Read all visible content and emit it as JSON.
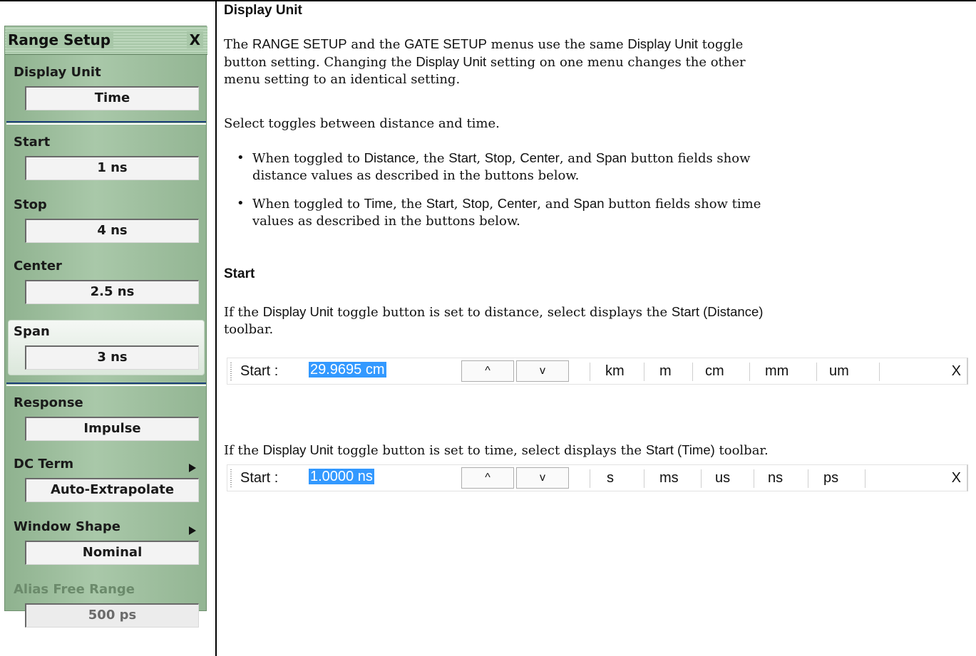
{
  "menu": {
    "title": "Range Setup",
    "close": "X",
    "items": [
      {
        "label": "Display Unit",
        "value": "Time"
      },
      {
        "label": "Start",
        "value": "1 ns"
      },
      {
        "label": "Stop",
        "value": "4 ns"
      },
      {
        "label": "Center",
        "value": "2.5 ns"
      },
      {
        "label": "Span",
        "value": "3 ns"
      },
      {
        "label": "Response",
        "value": "Impulse"
      },
      {
        "label": "DC Term",
        "value": "Auto-Extrapolate"
      },
      {
        "label": "Window Shape",
        "value": "Nominal"
      },
      {
        "label": "Alias Free Range",
        "value": "500 ps"
      }
    ]
  },
  "doc": {
    "display_unit": {
      "heading": "Display Unit",
      "p1": {
        "t1": "The ",
        "s1": "RANGE SETUP",
        "t2": " and the ",
        "s2": "GATE SETUP",
        "t3": " menus use the same ",
        "s3": "Display Unit",
        "t4": " toggle",
        "t5": "button setting. Changing the ",
        "s4": "Display Unit",
        "t6": " setting on one menu changes the other",
        "t7": "menu setting to an identical setting."
      },
      "p2": "Select toggles between distance and time.",
      "b1": {
        "t1": "When toggled to ",
        "s1": "Distance",
        "t2": ", the ",
        "s2": "Start",
        "t3": ", ",
        "s3": "Stop",
        "t4": ", ",
        "s4": "Center",
        "t5": ", and ",
        "s5": "Span",
        "t6": " button fields show",
        "t7": "distance values as described in the buttons below."
      },
      "b2": {
        "t1": "When toggled to ",
        "s1": "Time",
        "t2": ", the ",
        "s2": "Start",
        "t3": ", ",
        "s3": "Stop",
        "t4": ", ",
        "s4": "Center",
        "t5": ", and ",
        "s5": "Span",
        "t6": " button fields show time",
        "t7": "values as described in the buttons below."
      }
    },
    "start": {
      "heading": "Start",
      "p1": {
        "t1": "If the ",
        "s1": "Display Unit",
        "t2": " toggle button is set to distance, select displays the ",
        "s2": "Start (Distance)",
        "t3": "toolbar."
      },
      "p2": {
        "t1": "If the ",
        "s1": "Display Unit",
        "t2": " toggle button is set to time, select displays the ",
        "s2": "Start (Time)",
        "t3": " toolbar."
      }
    }
  },
  "toolbar_distance": {
    "label": "Start  :",
    "value": "29.9695 cm",
    "up": "^",
    "down": "v",
    "units": [
      "km",
      "m",
      "cm",
      "mm",
      "um"
    ],
    "close": "X"
  },
  "toolbar_time": {
    "label": "Start  :",
    "value": "1.0000 ns",
    "up": "^",
    "down": "v",
    "units": [
      "s",
      "ms",
      "us",
      "ns",
      "ps"
    ],
    "close": "X"
  }
}
